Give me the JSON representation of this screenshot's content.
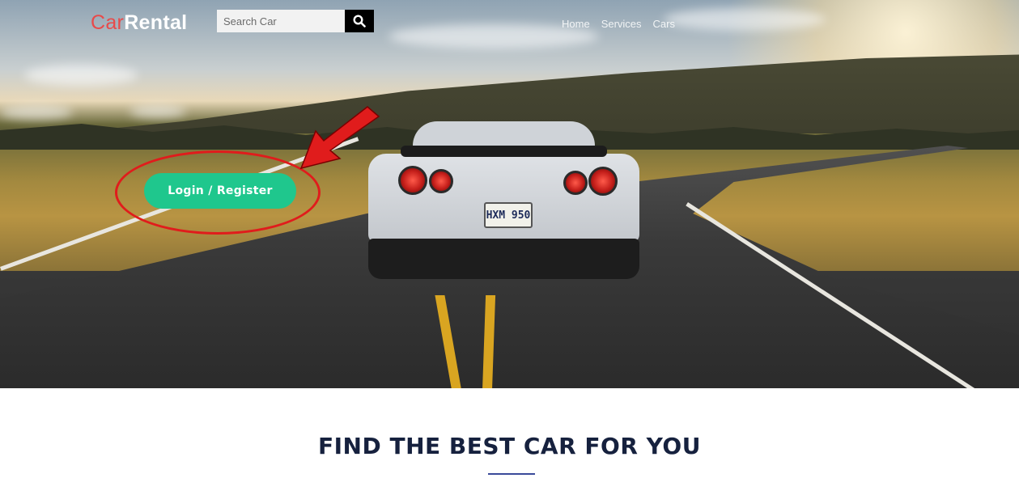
{
  "header": {
    "logo_part1": "Car",
    "logo_part2": "Rental",
    "search": {
      "placeholder": "Search Car",
      "button_icon": "search-icon"
    },
    "nav_items": [
      "Home",
      "Services",
      "Cars"
    ]
  },
  "hero": {
    "login_button_label": "Login / Register",
    "plate_text": "HXM 950",
    "annotation": {
      "shape": "ellipse",
      "pointer": "arrow",
      "color": "#e01c1c"
    }
  },
  "section": {
    "title": "FIND THE BEST CAR FOR YOU"
  },
  "colors": {
    "brand_red": "#e84a4a",
    "accent_green": "#1fc78d",
    "title_navy": "#16213e",
    "underline_blue": "#3a4a9a"
  }
}
